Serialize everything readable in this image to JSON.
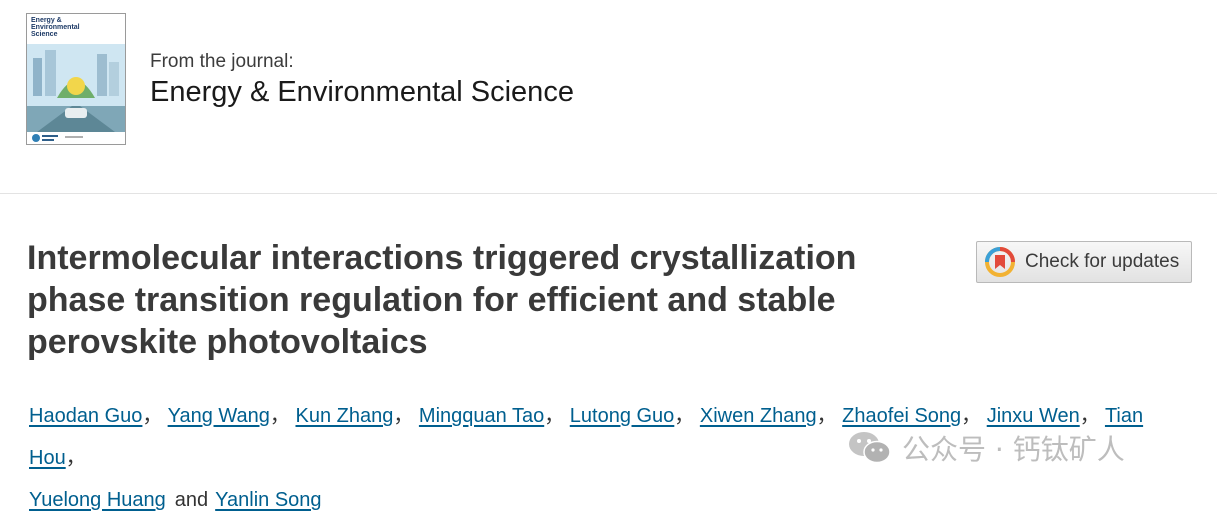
{
  "cover": {
    "title_lines": [
      "Energy &",
      "Environmental",
      "Science"
    ]
  },
  "journal": {
    "from_label": "From the journal:",
    "name": "Energy & Environmental Science"
  },
  "article": {
    "title": "Intermolecular interactions triggered crystallization phase transition regulation for efficient and stable perovskite photovoltaics"
  },
  "check_updates": {
    "label": "Check for updates"
  },
  "authors": {
    "list": [
      "Haodan Guo",
      "Yang Wang",
      "Kun Zhang",
      "Mingquan Tao",
      "Lutong Guo",
      "Xiwen Zhang",
      "Zhaofei Song",
      "Jinxu Wen",
      "Tian Hou",
      "Yuelong Huang",
      "Yanlin Song"
    ],
    "separator": "，",
    "conjunction": "and"
  },
  "watermark": {
    "text": "公众号 · 钙钛矿人",
    "icon": "wechat-icon"
  },
  "colors": {
    "link": "#005f8f",
    "title": "#3a3a3a"
  }
}
